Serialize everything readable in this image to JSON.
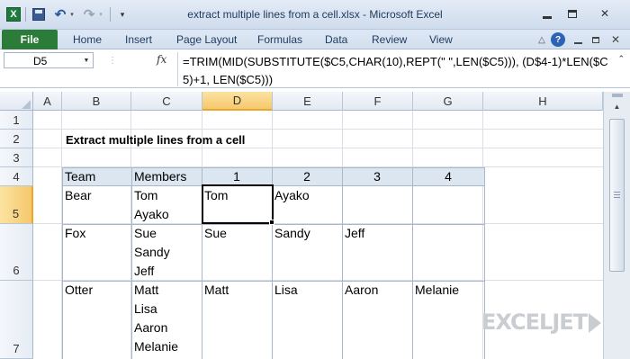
{
  "window": {
    "title": "extract multiple lines from a cell.xlsx  -  Microsoft Excel",
    "app_icon": "excel-icon",
    "controls": {
      "minimize": "minimize-icon",
      "maximize": "maximize-icon",
      "close": "✕"
    }
  },
  "quick_access": {
    "save": "save-icon",
    "undo": "↶",
    "redo": "↷",
    "dropdown": "▾",
    "customize": "▾"
  },
  "ribbon": {
    "file_tab": "File",
    "tabs": [
      "Home",
      "Insert",
      "Page Layout",
      "Formulas",
      "Data",
      "Review",
      "View"
    ],
    "right_icons": {
      "minimize_ribbon": "△",
      "help": "?",
      "close": "✕"
    }
  },
  "formula_bar": {
    "name_box": "D5",
    "fx": "fx",
    "formula": "=TRIM(MID(SUBSTITUTE($C5,CHAR(10),REPT(\" \",LEN($C5))), (D$4-1)*LEN($C5)+1, LEN($C5)))",
    "collapse": "⌃"
  },
  "sheet": {
    "columns": [
      "A",
      "B",
      "C",
      "D",
      "E",
      "F",
      "G",
      "H"
    ],
    "active_column": "D",
    "rows": [
      "1",
      "2",
      "3",
      "4",
      "5",
      "6",
      "7"
    ],
    "active_row": "5",
    "active_cell": "D5",
    "title": "Extract multiple lines from a cell",
    "table": {
      "headers": [
        "Team",
        "Members",
        "1",
        "2",
        "3",
        "4"
      ],
      "rows": [
        {
          "team": "Bear",
          "members": "Tom\nAyako",
          "values": [
            "Tom",
            "Ayako",
            "",
            ""
          ]
        },
        {
          "team": "Fox",
          "members": "Sue\nSandy\nJeff",
          "values": [
            "Sue",
            "Sandy",
            "Jeff",
            ""
          ]
        },
        {
          "team": "Otter",
          "members": "Matt\nLisa\nAaron\nMelanie",
          "values": [
            "Matt",
            "Lisa",
            "Aaron",
            "Melanie"
          ]
        }
      ]
    }
  },
  "watermark": {
    "text": "EXCELJET"
  },
  "colors": {
    "file_tab": "#2c7c39",
    "table_header": "#dce6f1",
    "active_header": "#f6c86d"
  }
}
